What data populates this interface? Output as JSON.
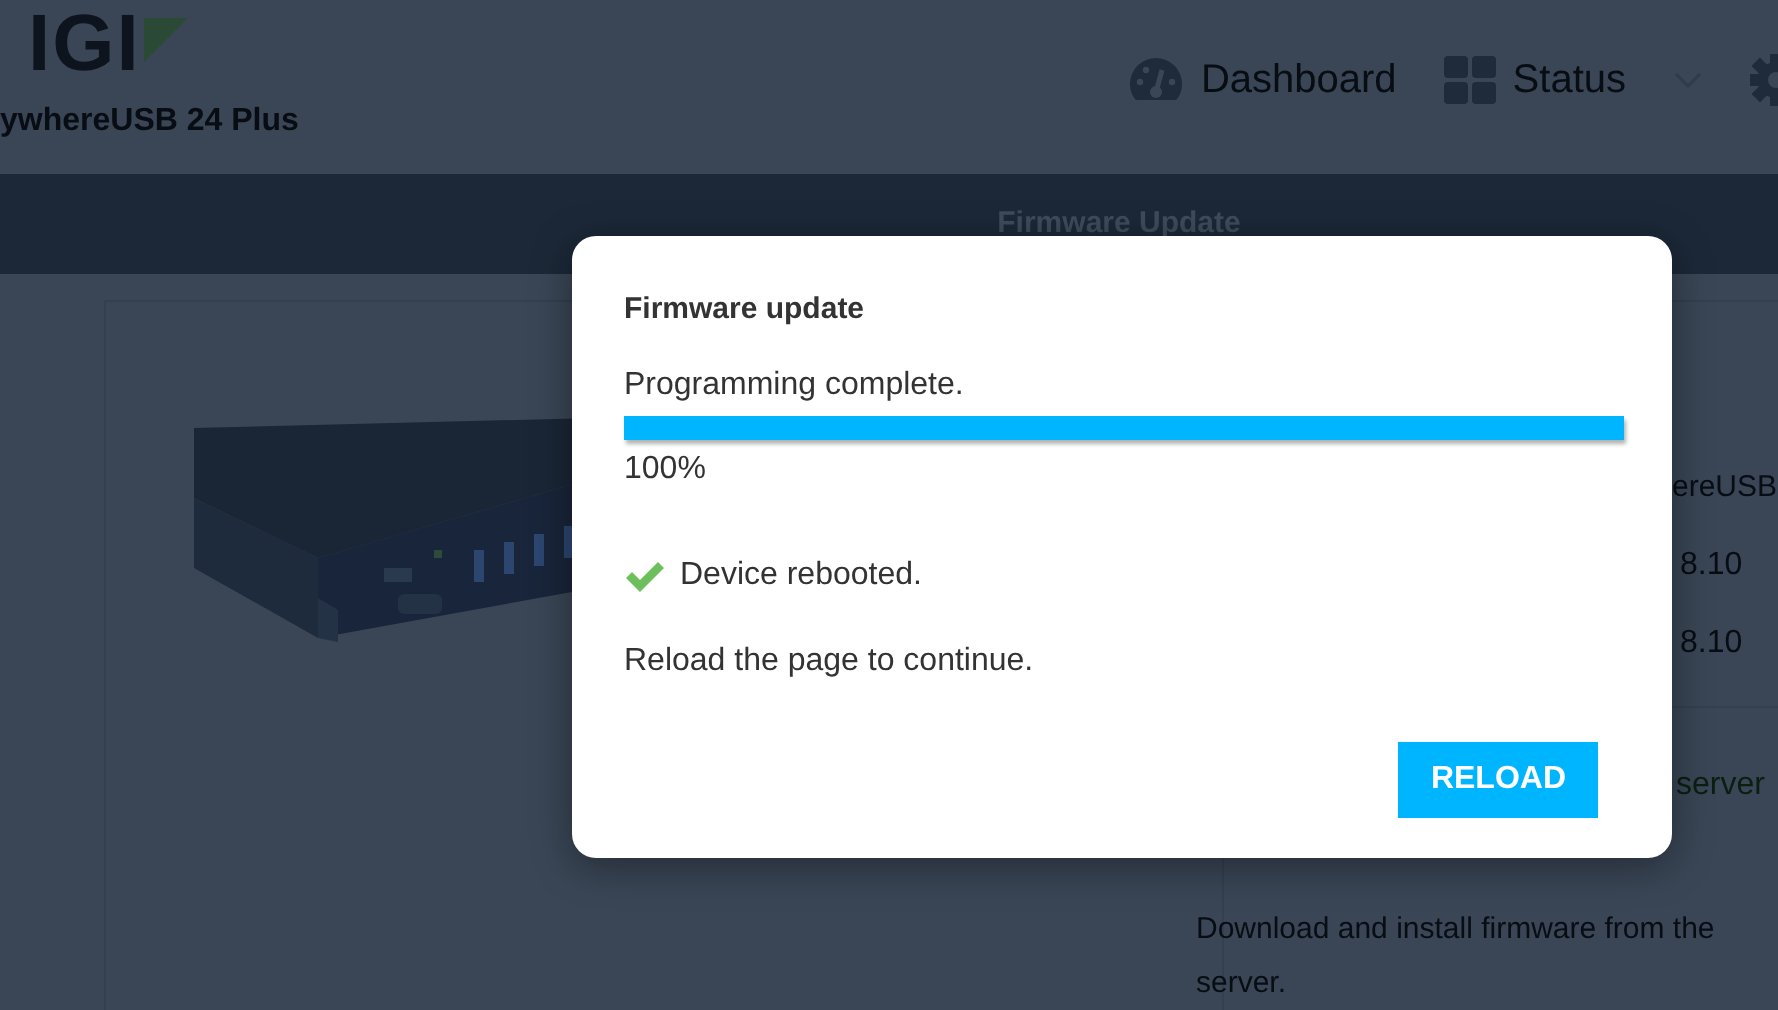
{
  "header": {
    "logo": "IGI",
    "product": "ywhereUSB 24 Plus",
    "nav": [
      {
        "kind": "gauge",
        "label": "Dashboard"
      },
      {
        "kind": "grid",
        "label": "Status"
      }
    ]
  },
  "page_bar": {
    "title": "Firmware Update"
  },
  "details": [
    "ereUSB",
    "8.10",
    "8.10"
  ],
  "server_link": "server",
  "description": "Download and install firmware from the server.",
  "dialog": {
    "title": "Firmware update",
    "status": "Programming complete.",
    "progress": {
      "level": 1.0,
      "reading": "100%"
    },
    "result": {
      "ok": true,
      "text": "Device rebooted."
    },
    "message": "Reload the page to continue.",
    "button": "RELOAD"
  }
}
